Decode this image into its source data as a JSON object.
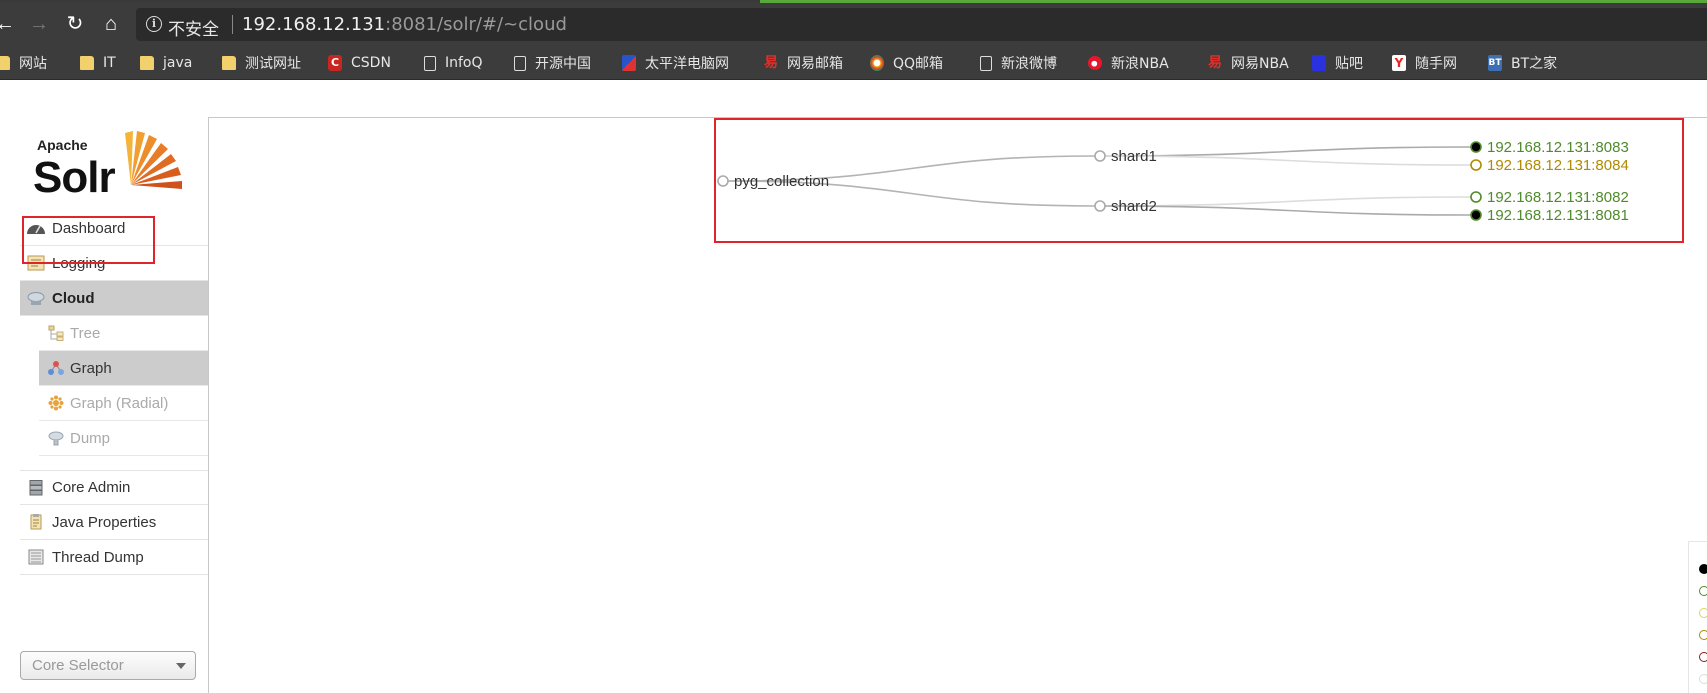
{
  "browser": {
    "address": {
      "security_label": "不安全",
      "url_host": "192.168.12.131",
      "url_rest": ":8081/solr/#/~cloud"
    },
    "bookmarks": [
      {
        "label": "网站",
        "icon": "folder-icon"
      },
      {
        "label": "IT",
        "icon": "folder-icon"
      },
      {
        "label": "java",
        "icon": "folder-icon"
      },
      {
        "label": "测试网址",
        "icon": "folder-icon"
      },
      {
        "label": "CSDN",
        "icon": "csdn-icon"
      },
      {
        "label": "InfoQ",
        "icon": "page-icon"
      },
      {
        "label": "开源中国",
        "icon": "page-icon"
      },
      {
        "label": "太平洋电脑网",
        "icon": "pconline-icon"
      },
      {
        "label": "网易邮箱",
        "icon": "netease-icon"
      },
      {
        "label": "QQ邮箱",
        "icon": "qqmail-icon"
      },
      {
        "label": "新浪微博",
        "icon": "page-icon"
      },
      {
        "label": "新浪NBA",
        "icon": "weibo-icon"
      },
      {
        "label": "网易NBA",
        "icon": "netease-icon"
      },
      {
        "label": "贴吧",
        "icon": "baidu-icon"
      },
      {
        "label": "随手网",
        "icon": "y-icon"
      },
      {
        "label": "BT之家",
        "icon": "bt-icon"
      }
    ]
  },
  "solr": {
    "logo": {
      "apache": "Apache",
      "solr": "Solr"
    },
    "nav": {
      "dashboard": "Dashboard",
      "logging": "Logging",
      "cloud": "Cloud",
      "cloud_sub": {
        "tree": "Tree",
        "graph": "Graph",
        "graph_radial": "Graph (Radial)",
        "dump": "Dump"
      },
      "core_admin": "Core Admin",
      "java_properties": "Java Properties",
      "thread_dump": "Thread Dump"
    },
    "core_selector": {
      "placeholder": "Core Selector"
    },
    "graph": {
      "collection": "pyg_collection",
      "shards": [
        {
          "name": "shard1",
          "replicas": [
            {
              "address": "192.168.12.131:8083",
              "state": "leader",
              "color": "#4f8b2a"
            },
            {
              "address": "192.168.12.131:8084",
              "state": "recovering",
              "color": "#b08a00"
            }
          ]
        },
        {
          "name": "shard2",
          "replicas": [
            {
              "address": "192.168.12.131:8082",
              "state": "active",
              "color": "#4f8b2a"
            },
            {
              "address": "192.168.12.131:8081",
              "state": "leader",
              "color": "#4f8b2a"
            }
          ]
        }
      ]
    },
    "legend_colors": [
      "#000000",
      "#4f8b2a",
      "#d8d36a",
      "#b08a00",
      "#8b2020",
      "#dddddd"
    ]
  }
}
